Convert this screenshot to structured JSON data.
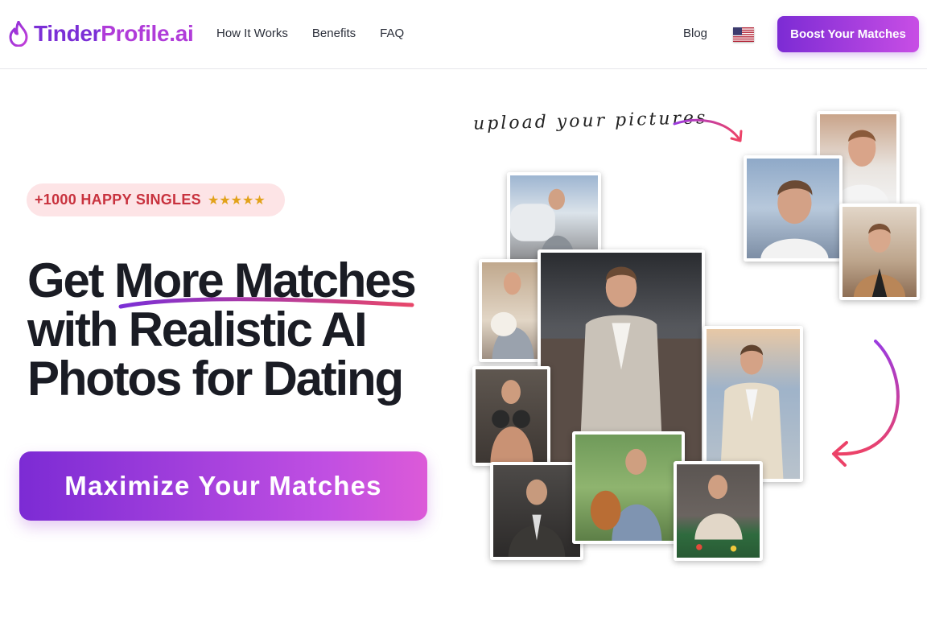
{
  "header": {
    "logo": {
      "part1": "Tinder",
      "part2": "Profile.ai",
      "icon": "flame-icon"
    },
    "nav": [
      {
        "label": "How It Works"
      },
      {
        "label": "Benefits"
      },
      {
        "label": "FAQ"
      }
    ],
    "blog_label": "Blog",
    "language_flag": "us-flag-icon",
    "boost_label": "Boost Your Matches"
  },
  "hero": {
    "badge_text": "+1000 HAPPY SINGLES",
    "badge_stars": "★★★★★",
    "headline": {
      "line1_a": "Get ",
      "line1_b": "More Matches",
      "line2": "with Realistic AI",
      "line3": "Photos for Dating"
    },
    "cta_label": "Maximize Your Matches"
  },
  "collage": {
    "hint": "upload your pictures"
  },
  "colors": {
    "brand_purple": "#7c2bd4",
    "brand_pink": "#c84ee5",
    "badge_bg": "#fde4e6",
    "badge_text": "#c8323e",
    "star": "#e2a21a",
    "headline": "#1a1c24"
  }
}
